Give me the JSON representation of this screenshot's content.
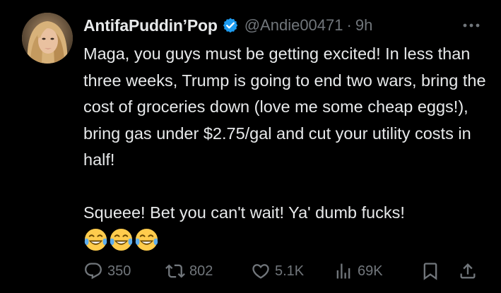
{
  "author": {
    "display_name": "AntifaPuddin’Pop",
    "handle": "@Andie00471",
    "separator": "·",
    "time": "9h",
    "verified_color": "#1d9bf0"
  },
  "tweet": {
    "paragraph1": "Maga, you guys must be getting excited! In less than three weeks, Trump is going to end two wars, bring the cost of groceries down (love me some cheap eggs!), bring gas under $2.75/gal and cut your utility costs in half!",
    "paragraph2": "Squeee! Bet you can't wait! Ya' dumb fucks!",
    "emojis": [
      "face-with-tears-of-joy",
      "face-with-tears-of-joy",
      "face-with-tears-of-joy"
    ]
  },
  "actions": {
    "replies": "350",
    "reposts": "802",
    "likes": "5.1K",
    "views": "69K"
  },
  "colors": {
    "background": "#000000",
    "text": "#e7e9ea",
    "muted": "#71767b"
  }
}
